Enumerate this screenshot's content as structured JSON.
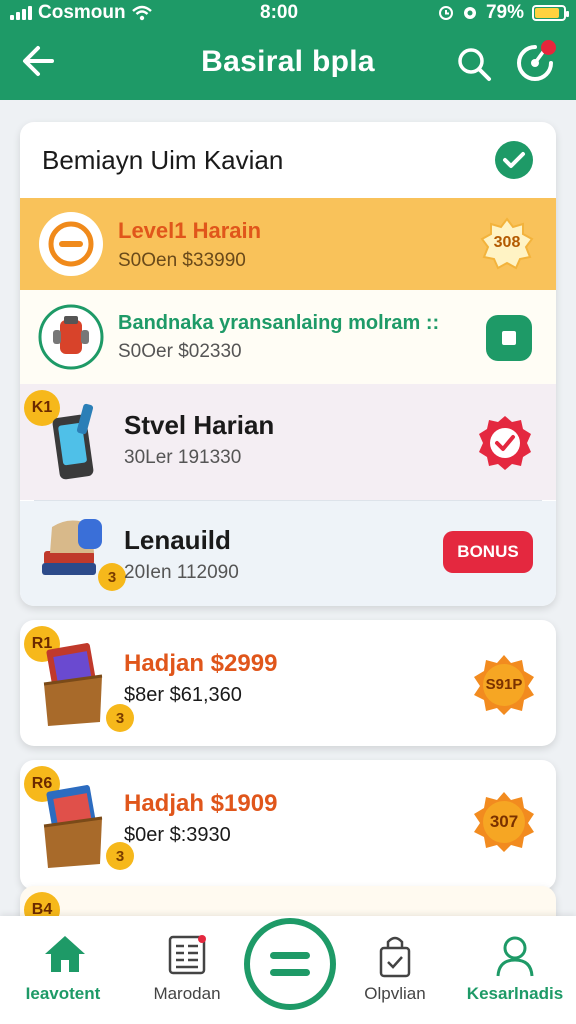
{
  "status": {
    "carrier": "Cosmoun",
    "time": "8:00",
    "battery": "79%"
  },
  "header": {
    "title": "Basiral bpla"
  },
  "summary": {
    "title": "Bemiayn Uim Kavian"
  },
  "items": [
    {
      "title": "Level1 Harain",
      "sub": "S0Oen $33990",
      "badge": "308"
    },
    {
      "title": "Bandnaka yransanlaing molram ::",
      "sub": "S0Oer $02330"
    },
    {
      "title": "Stvel Harian",
      "sub": "30Ler 191330",
      "rank": "K1"
    },
    {
      "title": "Lenauild",
      "sub": "20Ien 112090",
      "count": "3",
      "button": "BONUS"
    },
    {
      "title": "Hadjan $2999",
      "sub": "$8er $61,360",
      "rank": "R1",
      "count": "3",
      "badge": "S91P"
    },
    {
      "title": "Hadjah $1909",
      "sub": "$0er $:3930",
      "rank": "R6",
      "count": "3",
      "badge": "307"
    },
    {
      "rank": "B4"
    }
  ],
  "nav": [
    {
      "label": "Ieavotent",
      "color": "#1e9a67"
    },
    {
      "label": "Marodan",
      "color": "#444444"
    },
    {
      "label": "Olpvlian",
      "color": "#444444"
    },
    {
      "label": "Kesarlnadis",
      "color": "#1e9a67"
    }
  ],
  "colors": {
    "primary": "#1e9a67",
    "highlight": "#f9c25a",
    "accent_red": "#e4283f",
    "orange_text": "#e0561b",
    "green_text": "#1e9a67"
  }
}
